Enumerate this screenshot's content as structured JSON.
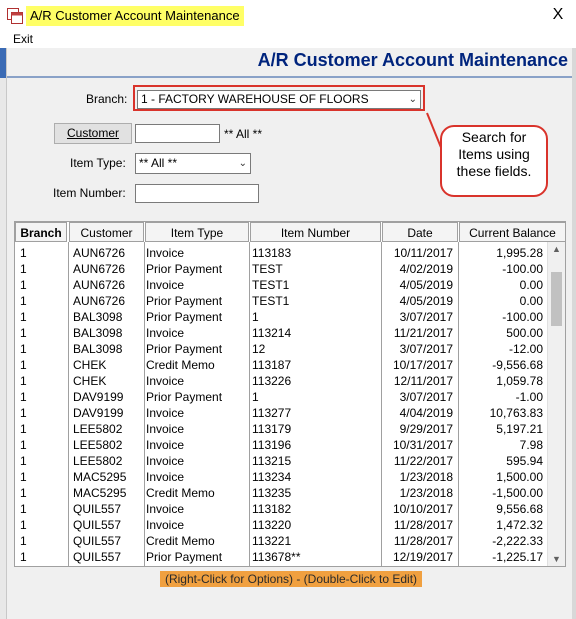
{
  "window": {
    "title": "A/R Customer Account Maintenance",
    "close_glyph": "X",
    "icon": "app-window-icon"
  },
  "menu": {
    "exit_label": "Exit"
  },
  "form": {
    "title": "A/R Customer Account Maintenance",
    "branch_label": "Branch:",
    "branch_value": "1  - FACTORY WAREHOUSE OF FLOORS",
    "customer_button": "Customer",
    "customer_value": "",
    "customer_all": "** All **",
    "item_type_label": "Item Type:",
    "item_type_value": "** All **",
    "item_number_label": "Item Number:",
    "item_number_value": ""
  },
  "callout": {
    "lines": [
      "Search for",
      "Items using",
      "these fields."
    ]
  },
  "table": {
    "columns": [
      "Branch",
      "Customer",
      "Item Type",
      "Item Number",
      "Date",
      "Current Balance"
    ],
    "rows": [
      [
        "1",
        "AUN6726",
        "Invoice",
        "113183",
        "10/11/2017",
        "1,995.28"
      ],
      [
        "1",
        "AUN6726",
        "Prior Payment",
        "TEST",
        "4/02/2019",
        "-100.00"
      ],
      [
        "1",
        "AUN6726",
        "Invoice",
        "TEST1",
        "4/05/2019",
        "0.00"
      ],
      [
        "1",
        "AUN6726",
        "Prior Payment",
        "TEST1",
        "4/05/2019",
        "0.00"
      ],
      [
        "1",
        "BAL3098",
        "Prior Payment",
        "1",
        "3/07/2017",
        "-100.00"
      ],
      [
        "1",
        "BAL3098",
        "Invoice",
        "113214",
        "11/21/2017",
        "500.00"
      ],
      [
        "1",
        "BAL3098",
        "Prior Payment",
        "12",
        "3/07/2017",
        "-12.00"
      ],
      [
        "1",
        "CHEK",
        "Credit Memo",
        "113187",
        "10/17/2017",
        "-9,556.68"
      ],
      [
        "1",
        "CHEK",
        "Invoice",
        "113226",
        "12/11/2017",
        "1,059.78"
      ],
      [
        "1",
        "DAV9199",
        "Prior Payment",
        "1",
        "3/07/2017",
        "-1.00"
      ],
      [
        "1",
        "DAV9199",
        "Invoice",
        "113277",
        "4/04/2019",
        "10,763.83"
      ],
      [
        "1",
        "LEE5802",
        "Invoice",
        "113179",
        "9/29/2017",
        "5,197.21"
      ],
      [
        "1",
        "LEE5802",
        "Invoice",
        "113196",
        "10/31/2017",
        "7.98"
      ],
      [
        "1",
        "LEE5802",
        "Invoice",
        "113215",
        "11/22/2017",
        "595.94"
      ],
      [
        "1",
        "MAC5295",
        "Invoice",
        "113234",
        "1/23/2018",
        "1,500.00"
      ],
      [
        "1",
        "MAC5295",
        "Credit Memo",
        "113235",
        "1/23/2018",
        "-1,500.00"
      ],
      [
        "1",
        "QUIL557",
        "Invoice",
        "113182",
        "10/10/2017",
        "9,556.68"
      ],
      [
        "1",
        "QUIL557",
        "Invoice",
        "113220",
        "11/28/2017",
        "1,472.32"
      ],
      [
        "1",
        "QUIL557",
        "Credit Memo",
        "113221",
        "11/28/2017",
        "-2,222.33"
      ],
      [
        "1",
        "QUIL557",
        "Prior Payment",
        "113678**",
        "12/19/2017",
        "-1,225.17"
      ]
    ]
  },
  "footer": {
    "hint": "(Right-Click for Options) - (Double-Click to Edit)"
  },
  "colors": {
    "title_highlight": "#ffff66",
    "callout_border": "#d9332b",
    "form_title": "#00247d",
    "footer_bg": "#f0a040"
  }
}
